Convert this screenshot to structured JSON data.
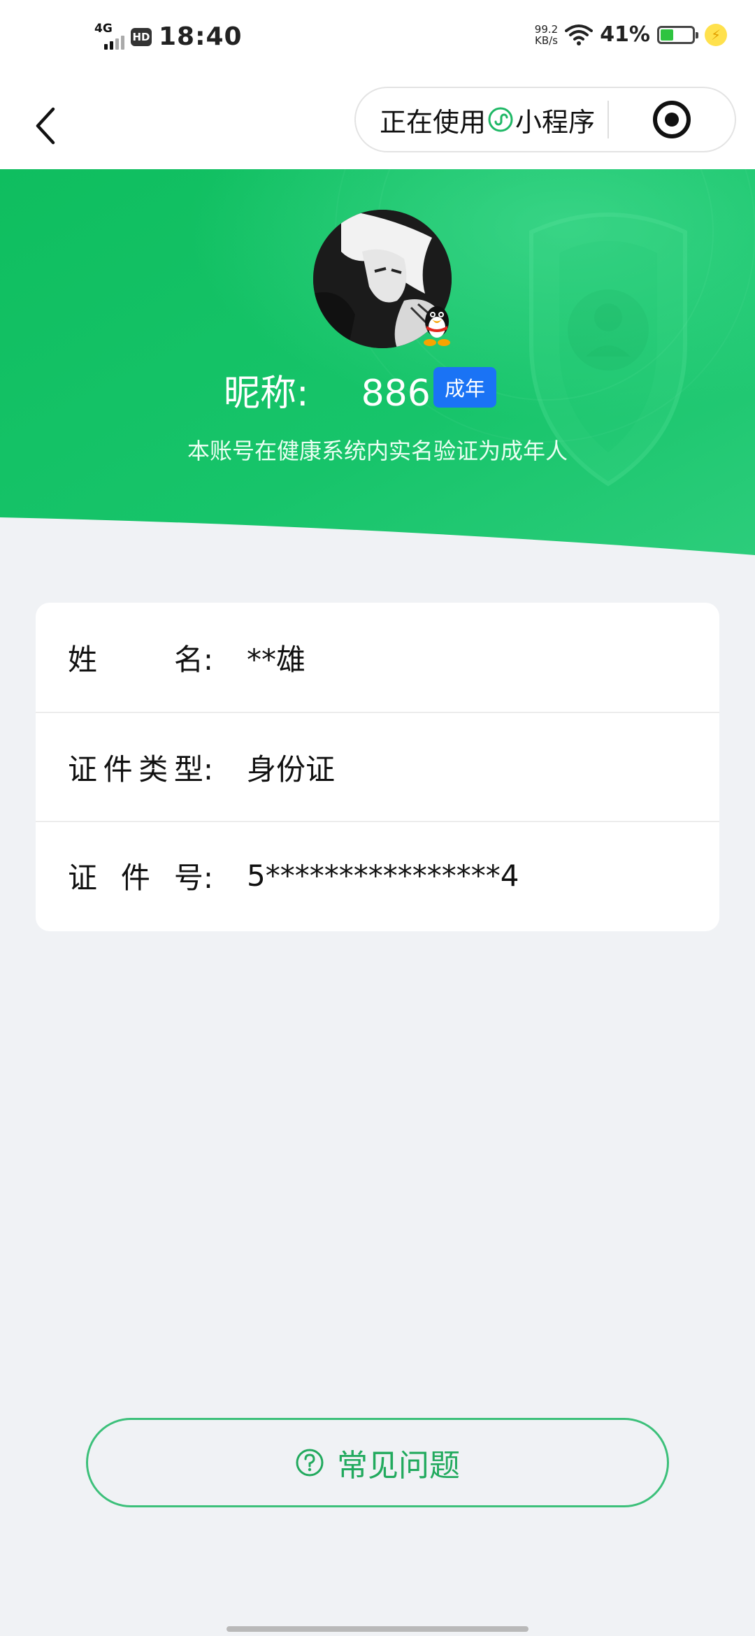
{
  "status_bar": {
    "network": "4G",
    "hd": "HD",
    "time": "18:40",
    "net_speed_value": "99.2",
    "net_speed_unit": "KB/s",
    "battery_percent": "41%",
    "battery_level": 0.41,
    "charging": true
  },
  "nav": {
    "back_icon": "chevron-left-icon",
    "capsule_prefix": "正在使用",
    "capsule_suffix": "小程序",
    "capsule_icon": "mini-program-icon",
    "target_icon": "target-icon"
  },
  "profile": {
    "nickname_label": "昵称:",
    "nickname_value": "886",
    "age_badge": "成年",
    "verify_text": "本账号在健康系统内实名验证为成年人",
    "avatar_icon": "avatar-image",
    "qq_icon": "qq-penguin-icon"
  },
  "info": {
    "rows": [
      {
        "label_chars": [
          "姓",
          "名:"
        ],
        "value": "**雄"
      },
      {
        "label_chars": [
          "证",
          "件",
          "类",
          "型:"
        ],
        "value": "身份证"
      },
      {
        "label_chars": [
          "证",
          "件",
          "号:"
        ],
        "value": "5****************4"
      }
    ]
  },
  "faq": {
    "label": "常见问题",
    "icon": "question-circle-icon"
  },
  "colors": {
    "brand_green": "#12c06a",
    "badge_blue": "#1a73f5",
    "faq_green": "#22aa5e",
    "page_bg": "#f0f2f5"
  }
}
